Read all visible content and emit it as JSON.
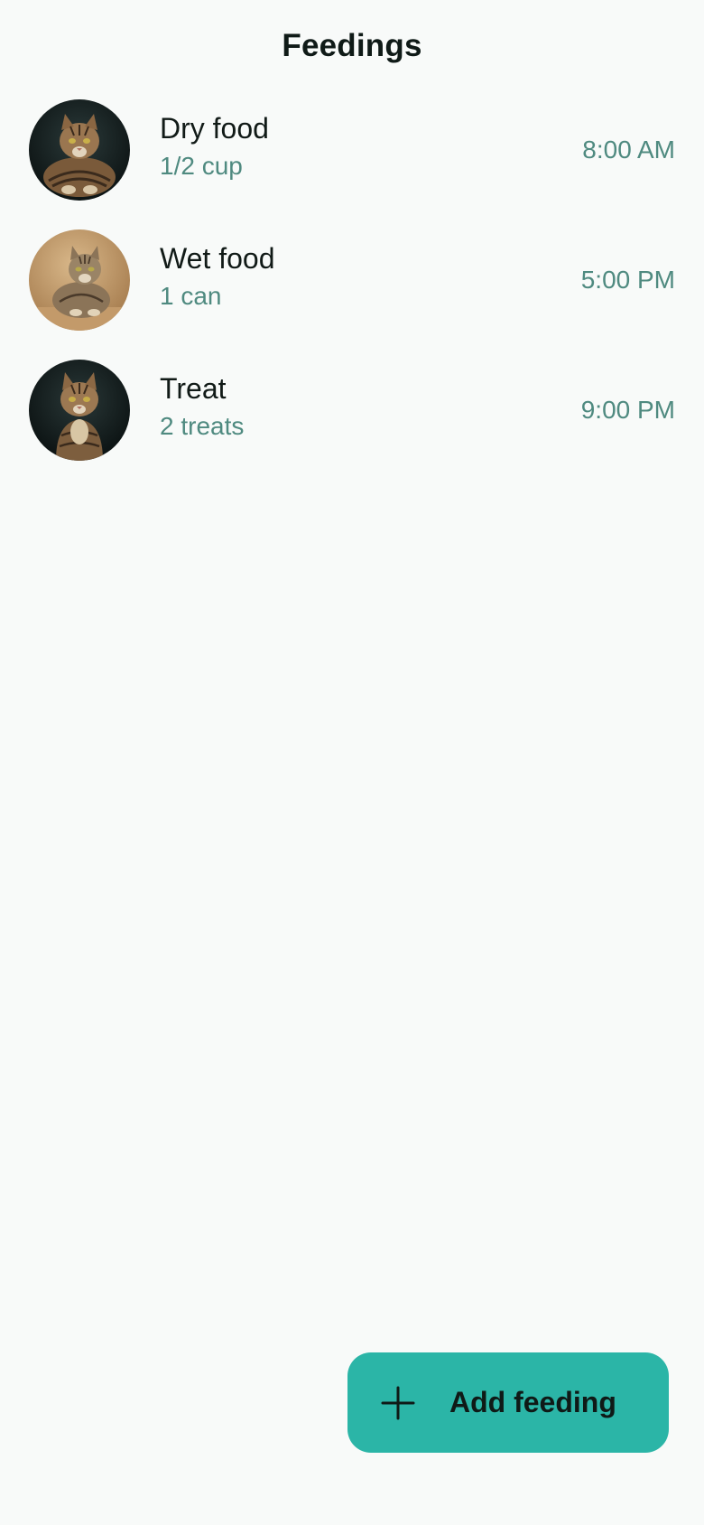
{
  "header": {
    "title": "Feedings"
  },
  "feedings": [
    {
      "title": "Dry food",
      "amount": "1/2 cup",
      "time": "8:00 AM",
      "avatar": "cat-photo-dark"
    },
    {
      "title": "Wet food",
      "amount": "1 can",
      "time": "5:00 PM",
      "avatar": "cat-photo-tan"
    },
    {
      "title": "Treat",
      "amount": "2 treats",
      "time": "9:00 PM",
      "avatar": "cat-photo-dark"
    }
  ],
  "fab": {
    "label": "Add feeding",
    "icon": "plus-icon"
  },
  "colors": {
    "background": "#f8faf9",
    "primary_text": "#111a17",
    "secondary_text": "#4f8a80",
    "accent": "#2bb5a7"
  }
}
